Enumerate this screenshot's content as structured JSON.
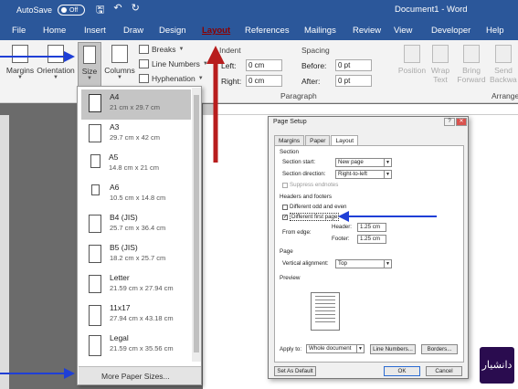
{
  "titlebar": {
    "autosave": "AutoSave",
    "autosave_state": "Off",
    "document": "Document1 - Word"
  },
  "tabs": [
    "File",
    "Home",
    "Insert",
    "Draw",
    "Design",
    "Layout",
    "References",
    "Mailings",
    "Review",
    "View",
    "Developer",
    "Help"
  ],
  "active_tab": "Layout",
  "ribbon": {
    "margins": "Margins",
    "orientation": "Orientation",
    "size": "Size",
    "columns": "Columns",
    "breaks": "Breaks",
    "line_numbers": "Line Numbers",
    "hyphenation": "Hyphenation",
    "indent": "Indent",
    "spacing": "Spacing",
    "left_label": "Left:",
    "left_value": "0 cm",
    "right_label": "Right:",
    "right_value": "0 cm",
    "before_label": "Before:",
    "before_value": "0 pt",
    "after_label": "After:",
    "after_value": "0 pt",
    "paragraph_group": "Paragraph",
    "position": "Position",
    "wrap_text": "Wrap Text",
    "bring_forward": "Bring Forward",
    "send_backward": "Send Backward",
    "arrange_group": "Arrange"
  },
  "paper_sizes": [
    {
      "name": "A4",
      "dims": "21 cm x 29.7 cm"
    },
    {
      "name": "A3",
      "dims": "29.7 cm x 42 cm"
    },
    {
      "name": "A5",
      "dims": "14.8 cm x 21 cm"
    },
    {
      "name": "A6",
      "dims": "10.5 cm x 14.8 cm"
    },
    {
      "name": "B4 (JIS)",
      "dims": "25.7 cm x 36.4 cm"
    },
    {
      "name": "B5 (JIS)",
      "dims": "18.2 cm x 25.7 cm"
    },
    {
      "name": "Letter",
      "dims": "21.59 cm x 27.94 cm"
    },
    {
      "name": "11x17",
      "dims": "27.94 cm x 43.18 cm"
    },
    {
      "name": "Legal",
      "dims": "21.59 cm x 35.56 cm"
    }
  ],
  "selected_paper": "A4",
  "more_paper_sizes": "More Paper Sizes...",
  "dialog": {
    "title": "Page Setup",
    "tabs": [
      "Margins",
      "Paper",
      "Layout"
    ],
    "active_tab": "Layout",
    "section_header": "Section",
    "section_start_label": "Section start:",
    "section_start_value": "New page",
    "section_direction_label": "Section direction:",
    "section_direction_value": "Right-to-left",
    "suppress_endnotes": "Suppress endnotes",
    "headers_footers_header": "Headers and footers",
    "diff_odd_even": "Different odd and even",
    "diff_first_page": "Different first page",
    "from_edge": "From edge:",
    "header_label": "Header:",
    "header_value": "1.25 cm",
    "footer_label": "Footer:",
    "footer_value": "1.25 cm",
    "page_header": "Page",
    "vertical_alignment_label": "Vertical alignment:",
    "vertical_alignment_value": "Top",
    "preview_header": "Preview",
    "apply_to_label": "Apply to:",
    "apply_to_value": "Whole document",
    "line_numbers_btn": "Line Numbers...",
    "borders_btn": "Borders...",
    "set_default_btn": "Set As Default",
    "ok_btn": "OK",
    "cancel_btn": "Cancel"
  },
  "colors": {
    "word_blue": "#2b579a",
    "arrow_blue": "#1f3fd6",
    "arrow_red": "#b81d1d"
  }
}
